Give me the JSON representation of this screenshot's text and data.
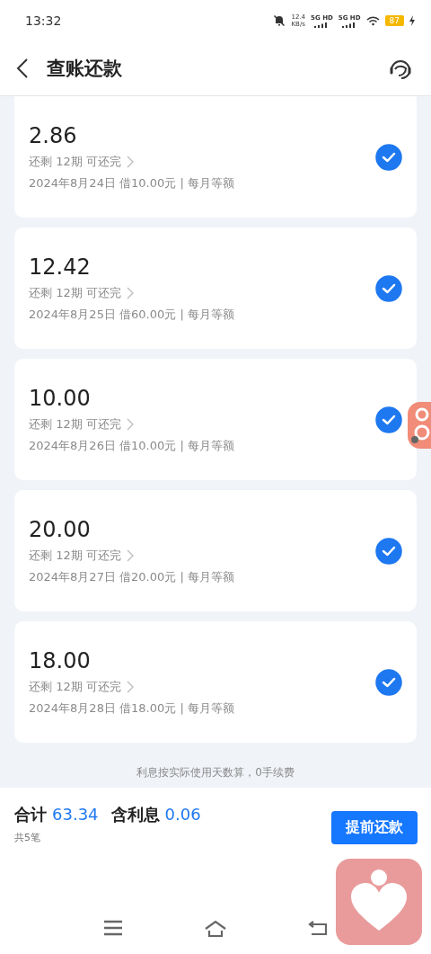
{
  "status_bar": {
    "time": "13:32",
    "net_speed": "12.4",
    "net_unit": "KB/s",
    "signals": [
      "5G HD",
      "5G HD"
    ],
    "battery": "87",
    "charging": true
  },
  "header": {
    "title": "查账还款"
  },
  "bills": [
    {
      "amount": "2.86",
      "remaining": "还剩 12期 可还完",
      "detail": "2024年8月24日 借10.00元 | 每月等额",
      "checked": true
    },
    {
      "amount": "12.42",
      "remaining": "还剩 12期 可还完",
      "detail": "2024年8月25日 借60.00元 | 每月等额",
      "checked": true
    },
    {
      "amount": "10.00",
      "remaining": "还剩 12期 可还完",
      "detail": "2024年8月26日 借10.00元 | 每月等额",
      "checked": true
    },
    {
      "amount": "20.00",
      "remaining": "还剩 12期 可还完",
      "detail": "2024年8月27日 借20.00元 | 每月等额",
      "checked": true
    },
    {
      "amount": "18.00",
      "remaining": "还剩 12期 可还完",
      "detail": "2024年8月28日 借18.00元 | 每月等额",
      "checked": true
    }
  ],
  "note": "利息按实际使用天数算，0手续费",
  "summary": {
    "total_label": "合计",
    "total": "63.34",
    "interest_label": "含利息",
    "interest": "0.06",
    "count": "共5笔",
    "button": "提前还款"
  }
}
